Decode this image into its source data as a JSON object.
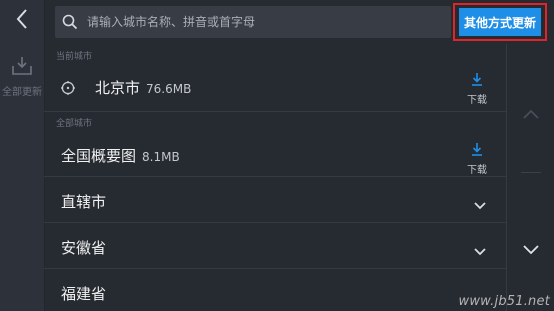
{
  "header": {
    "search_placeholder": "请输入城市名称、拼音或首字母",
    "other_methods_label": "其他方式更新"
  },
  "sidebar": {
    "update_all_label": "全部更新"
  },
  "current_city": {
    "section_label": "当前城市",
    "name": "北京市",
    "size": "76.6MB",
    "download_label": "下载"
  },
  "all_cities": {
    "section_label": "全部城市",
    "overview": {
      "name": "全国概要图",
      "size": "8.1MB",
      "download_label": "下载"
    },
    "groups": [
      {
        "name": "直辖市"
      },
      {
        "name": "安徽省"
      },
      {
        "name": "福建省"
      }
    ]
  },
  "watermark": "www.jb51.net",
  "colors": {
    "accent_blue": "#1f8ee6",
    "highlight_red": "#e0242a",
    "background": "#262a31"
  }
}
